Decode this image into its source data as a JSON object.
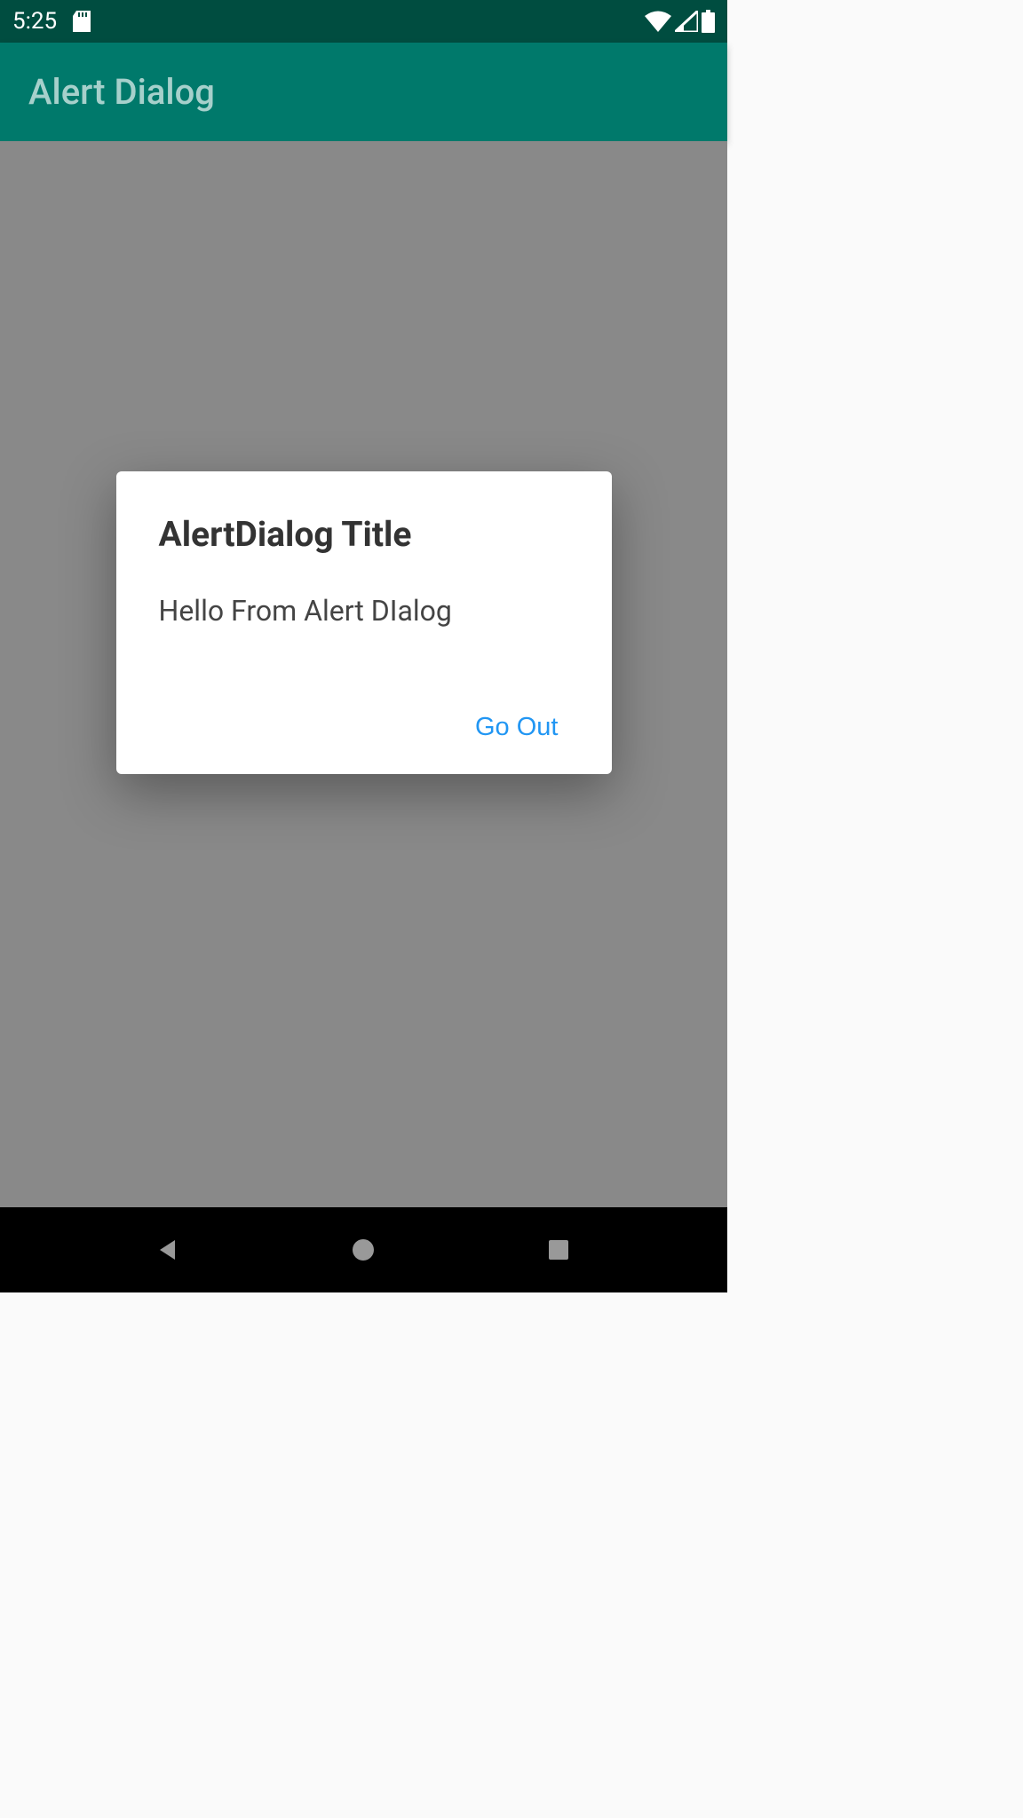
{
  "statusBar": {
    "time": "5:25"
  },
  "appBar": {
    "title": "Alert Dialog"
  },
  "dialog": {
    "title": "AlertDialog Title",
    "message": "Hello From Alert DIalog",
    "confirmLabel": "Go Out"
  },
  "colors": {
    "statusBarBg": "#004d40",
    "appBarBg": "#00796b",
    "accent": "#2196f3"
  }
}
